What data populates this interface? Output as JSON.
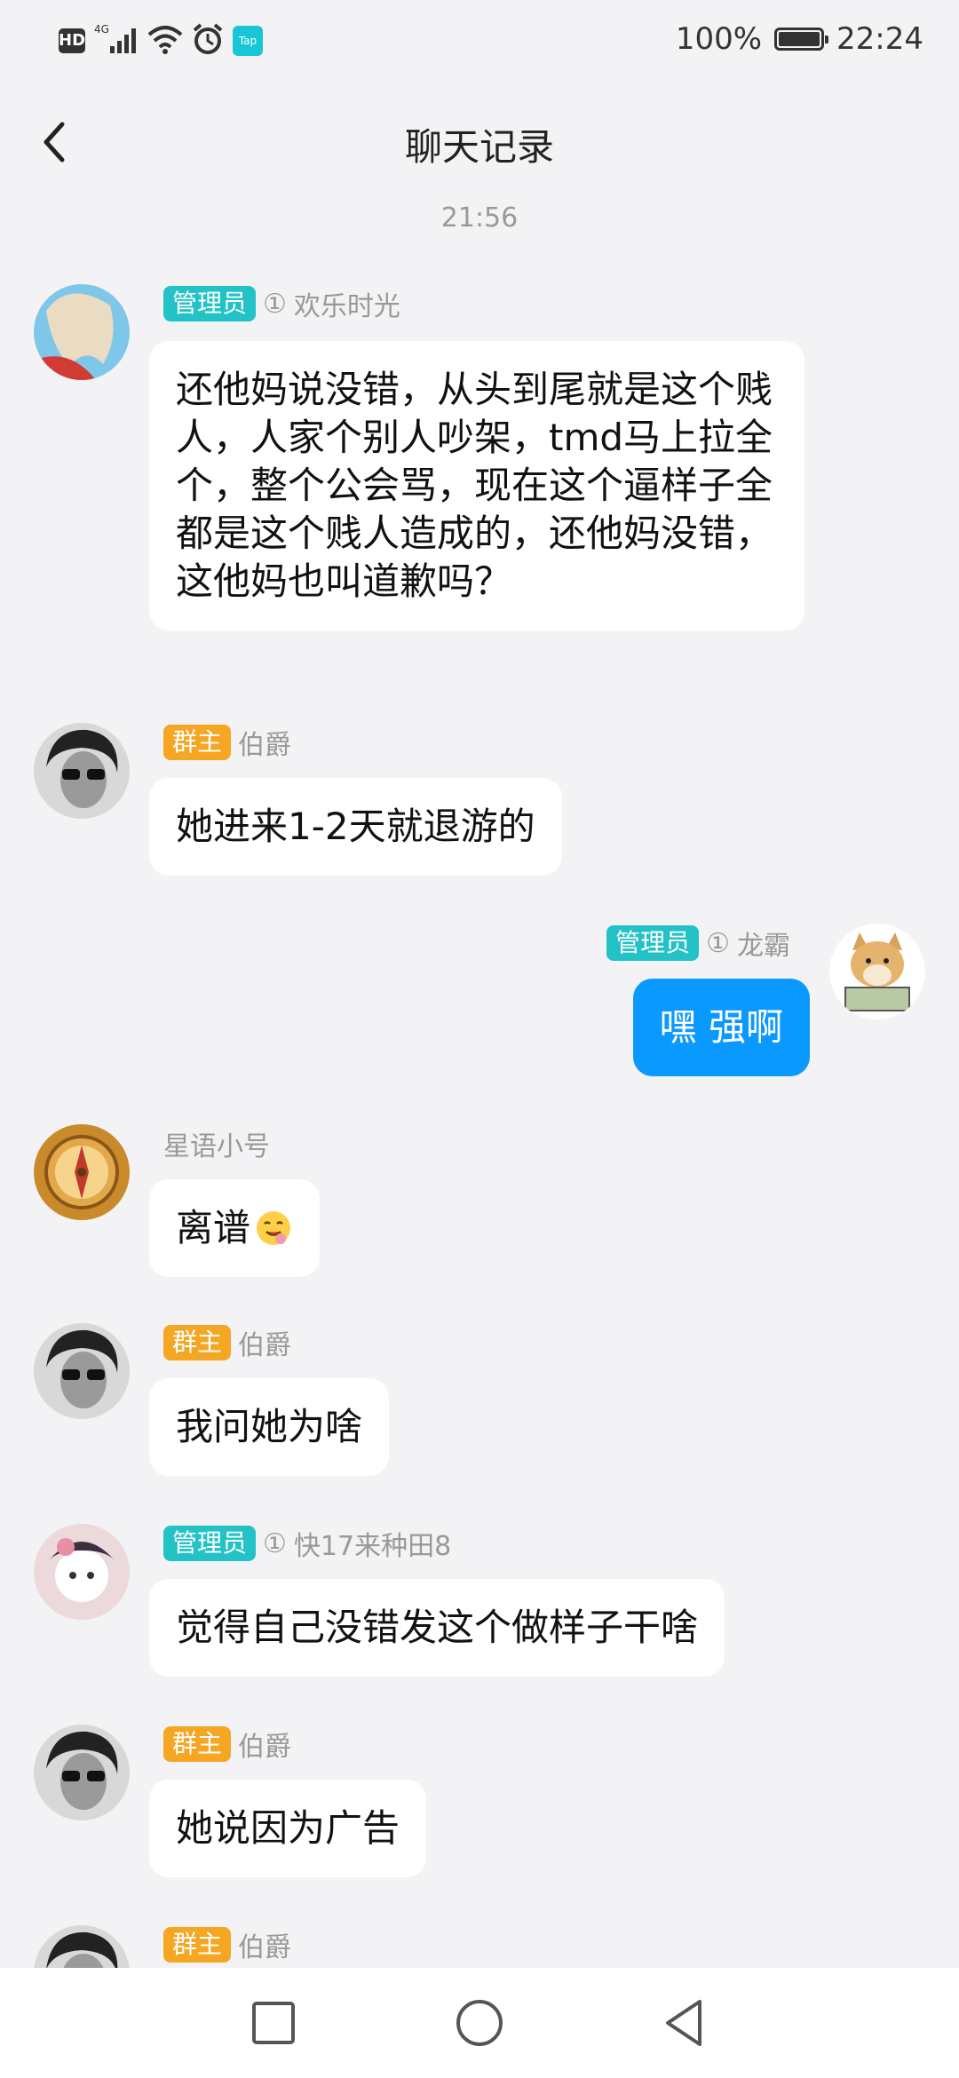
{
  "status_bar": {
    "hd_label": "HD",
    "network_label": "4G",
    "app_badge": "Tap",
    "battery_text": "100%",
    "battery_level": 1.0,
    "time": "22:24"
  },
  "header": {
    "title": "聊天记录"
  },
  "timestamp": "21:56",
  "messages": [
    {
      "role_badge": "管理员",
      "level": "①",
      "sender": "欢乐时光",
      "text": "还他妈说没错，从头到尾就是这个贱人，人家个别人吵架，tmd马上拉全个，整个公会骂，现在这个逼样子全都是这个贱人造成的，还他妈没错，这他妈也叫道歉吗？"
    },
    {
      "role_badge": "群主",
      "sender": "伯爵",
      "text": "她进来1-2天就退游的"
    },
    {
      "role_badge": "管理员",
      "level": "①",
      "sender": "龙霸",
      "text": "嘿 强啊"
    },
    {
      "sender": "星语小号",
      "text": "离谱"
    },
    {
      "role_badge": "群主",
      "sender": "伯爵",
      "text": "我问她为啥"
    },
    {
      "role_badge": "管理员",
      "level": "①",
      "sender": "快17来种田8",
      "text": "觉得自己没错发这个做样子干啥"
    },
    {
      "role_badge": "群主",
      "sender": "伯爵",
      "text": "她说因为广告"
    },
    {
      "role_badge": "群主",
      "sender": "伯爵",
      "text": ""
    }
  ],
  "colors": {
    "admin_badge": "#22c2c6",
    "owner_badge": "#f5a623",
    "self_bubble": "#0a99ff",
    "background": "#f3f3f5"
  }
}
